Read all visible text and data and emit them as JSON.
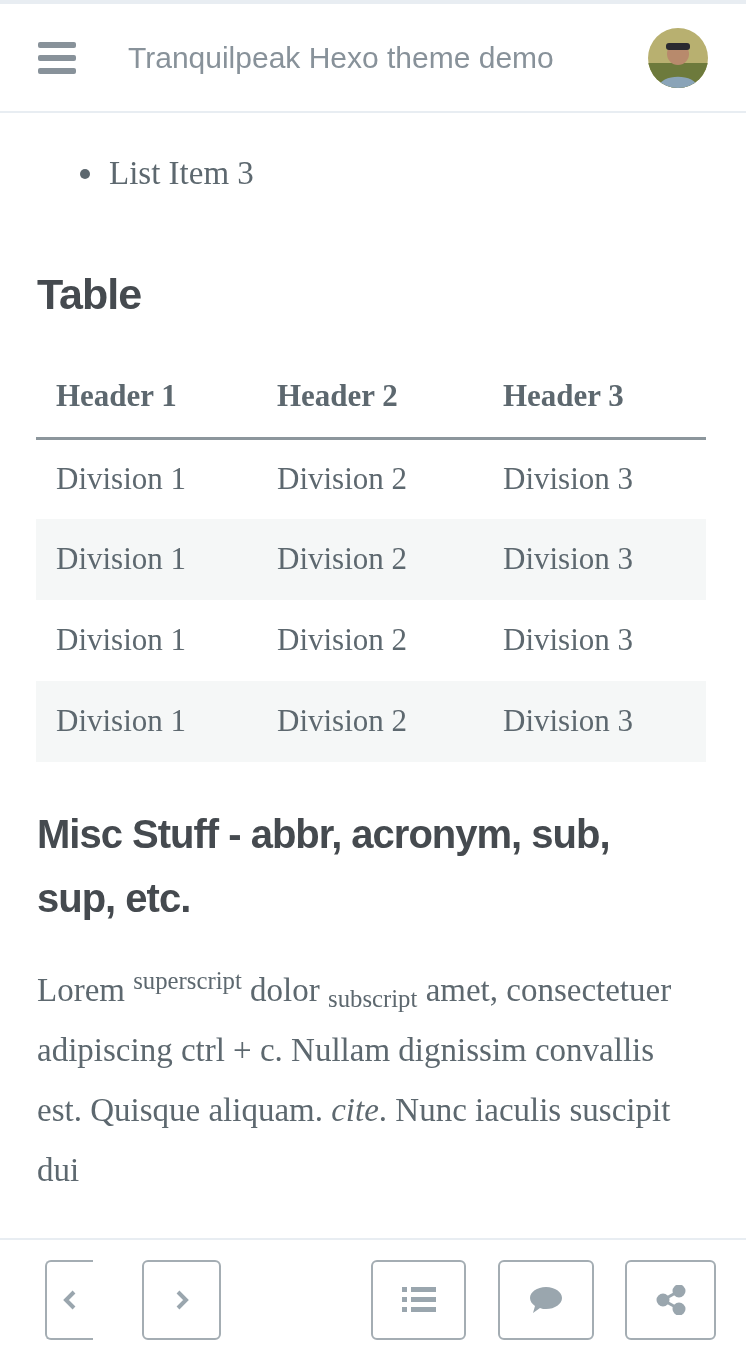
{
  "header": {
    "title": "Tranquilpeak Hexo theme demo"
  },
  "list": [
    "List Item 3"
  ],
  "table_heading": "Table",
  "table": {
    "columns": [
      "Header 1",
      "Header 2",
      "Header 3"
    ],
    "rows": [
      [
        "Division 1",
        "Division 2",
        "Division 3"
      ],
      [
        "Division 1",
        "Division 2",
        "Division 3"
      ],
      [
        "Division 1",
        "Division 2",
        "Division 3"
      ],
      [
        "Division 1",
        "Division 2",
        "Division 3"
      ]
    ]
  },
  "misc_heading": "Misc Stuff - abbr, acronym, sub, sup, etc.",
  "paragraph": "Lorem $^{superscript}$ dolor $_{subscript}$ amet, consectetuer adipiscing ctrl + c. Nullam dignissim convallis est. Quisque aliquam. *cite*. Nunc iaculis suscipit dui",
  "footer": {
    "buttons": [
      {
        "kind": "prev"
      },
      {
        "kind": "next"
      },
      {
        "kind": "toc"
      },
      {
        "kind": "comment"
      },
      {
        "kind": "share"
      }
    ]
  }
}
